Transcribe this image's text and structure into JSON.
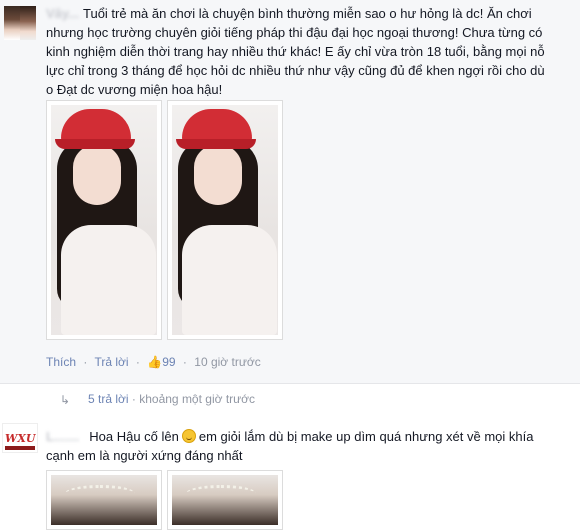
{
  "comment1": {
    "author_blurred": "Vây...",
    "text": "Tuổi trẻ mà ăn chơi là chuyện bình thường miễn sao o hư hỏng là dc! Ăn chơi nhưng học trường chuyên giỏi tiếng pháp thi đậu đại học ngoại thương! Chưa từng có kinh nghiệm diễn thời trang hay nhiều thứ khác! E ấy chỉ vừa tròn 18 tuổi, bằng mọi nỗ lực chỉ trong 3 tháng để học hỏi dc nhiều thứ như vậy cũng đủ để khen ngợi rồi cho dù o Đạt dc vương miện hoa hậu!",
    "actions": {
      "like": "Thích",
      "reply": "Trả lời",
      "like_count": "99",
      "time": "10 giờ trước"
    }
  },
  "replies": {
    "count_label": "5 trả lời",
    "time": "khoảng một giờ trước"
  },
  "comment2": {
    "author_blurred": "L.......",
    "text_before": "Hoa Hậu cố lên",
    "text_after": "em giỏi lắm dù bị make up dìm quá nhưng xét về mọi khía cạnh em là người xứng đáng nhất",
    "avatar_logo": "WXU"
  },
  "icons": {
    "like": "thumbs-up-icon",
    "reply": "reply-arrow-icon",
    "emoji": "smile-emoji-icon"
  },
  "colors": {
    "link": "#6d84b4",
    "meta": "#9197a3",
    "comment_bg": "#f6f7f9",
    "hat_red": "#d22d35"
  }
}
